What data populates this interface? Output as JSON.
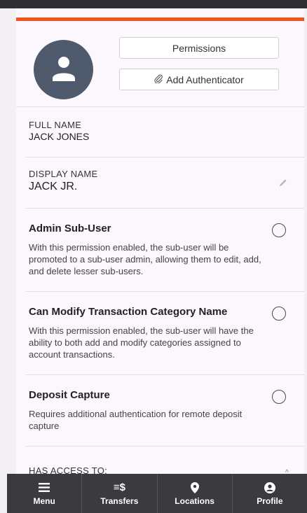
{
  "profile": {
    "permissions_button": "Permissions",
    "add_auth_button": "Add Authenticator",
    "full_name_label": "FULL NAME",
    "full_name": "JACK JONES",
    "display_name_label": "DISPLAY NAME",
    "display_name": "JACK JR."
  },
  "permissions": [
    {
      "title": "Admin Sub-User",
      "description": "With this permission enabled, the sub-user will be promoted to a sub-user admin, allowing them to edit, add, and delete lesser sub-users.",
      "enabled": false
    },
    {
      "title": "Can Modify Transaction Category Name",
      "description": "With this permission enabled, the sub-user will have the ability to both add and modify categories assigned to account transactions.",
      "enabled": false
    },
    {
      "title": "Deposit Capture",
      "description": "Requires additional authentication for remote deposit capture",
      "enabled": false
    }
  ],
  "access_section": {
    "label": "HAS ACCESS TO:"
  },
  "nav": {
    "items": [
      {
        "label": "Menu",
        "icon": "menu-icon"
      },
      {
        "label": "Transfers",
        "icon": "transfers-icon",
        "glyph": "≡$"
      },
      {
        "label": "Locations",
        "icon": "location-pin-icon"
      },
      {
        "label": "Profile",
        "icon": "profile-icon"
      }
    ]
  },
  "colors": {
    "accent": "#f4511e",
    "avatar_bg": "#4f5b6d",
    "nav_bg": "#3b3b3f",
    "panel_bg": "#fcf7fd"
  }
}
